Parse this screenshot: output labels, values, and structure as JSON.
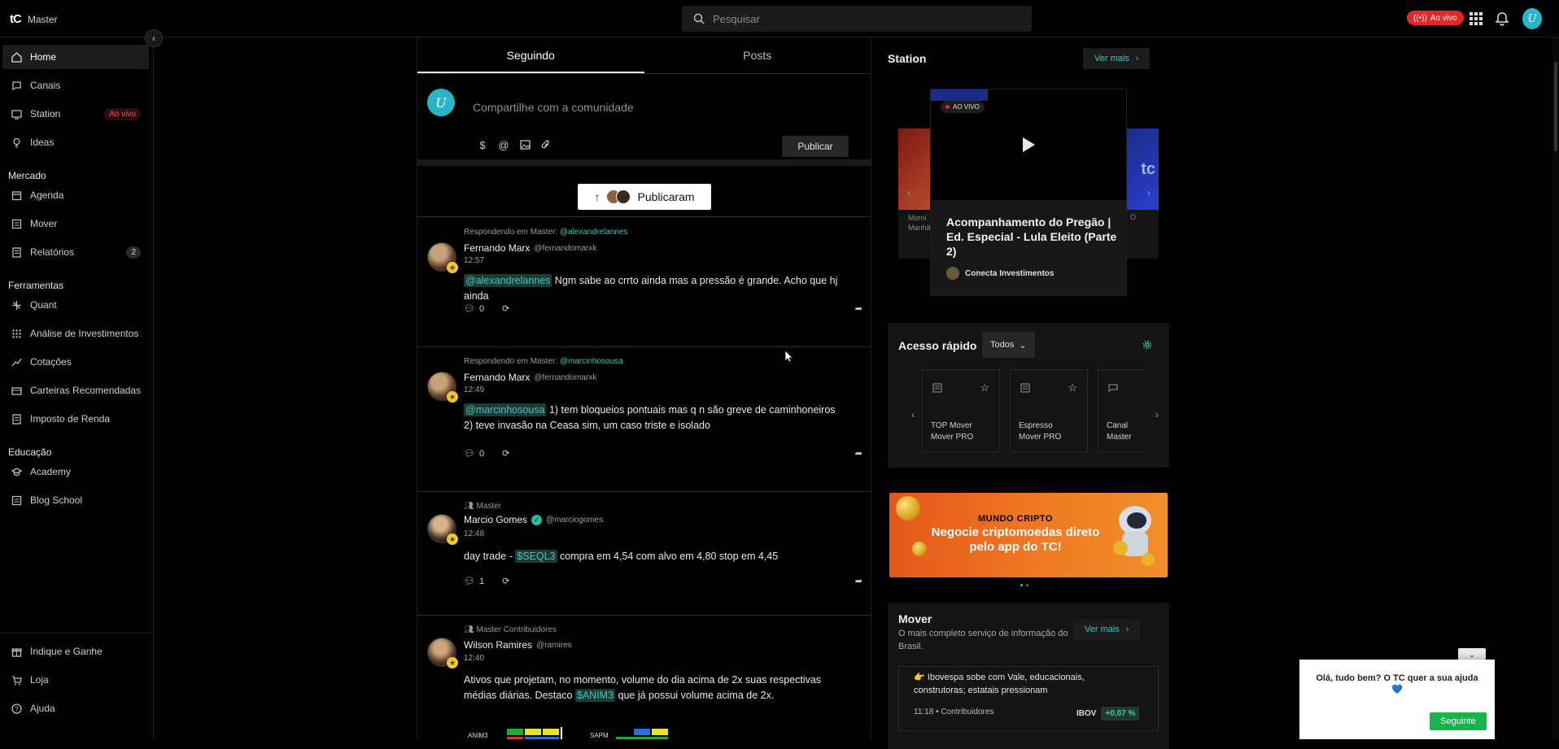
{
  "brand": {
    "logo": "tC",
    "plan": "Master"
  },
  "search": {
    "placeholder": "Pesquisar"
  },
  "topbar": {
    "live_label": "Ao vivo",
    "user_initial": "U"
  },
  "sidebar": {
    "items": [
      {
        "label": "Home",
        "icon": "home-icon"
      },
      {
        "label": "Canais",
        "icon": "channels-icon"
      },
      {
        "label": "Station",
        "icon": "tv-icon",
        "badge": "Ao vivo"
      },
      {
        "label": "Ideas",
        "icon": "lightbulb-icon"
      }
    ],
    "sections": [
      {
        "title": "Mercado",
        "items": [
          {
            "label": "Agenda"
          },
          {
            "label": "Mover"
          },
          {
            "label": "Relatórios",
            "count": "2"
          }
        ]
      },
      {
        "title": "Ferramentas",
        "items": [
          {
            "label": "Quant"
          },
          {
            "label": "Análise de Investimentos"
          },
          {
            "label": "Cotações"
          },
          {
            "label": "Carteiras Recomendadas"
          },
          {
            "label": "Imposto de Renda"
          }
        ]
      },
      {
        "title": "Educação",
        "items": [
          {
            "label": "Academy"
          },
          {
            "label": "Blog School"
          }
        ]
      }
    ],
    "bottom": [
      {
        "label": "Indique e Ganhe"
      },
      {
        "label": "Loja"
      },
      {
        "label": "Ajuda"
      }
    ]
  },
  "feed": {
    "tabs": [
      {
        "label": "Seguindo",
        "active": true
      },
      {
        "label": "Posts",
        "active": false
      }
    ],
    "composer": {
      "placeholder": "Compartilhe com a comunidade",
      "publish_label": "Publicar",
      "user_initial": "U"
    },
    "published_label": "Publicaram",
    "posts": [
      {
        "context_prefix": "Respondendo em Master:",
        "context_mention": "@alexandrelannes",
        "author": "Fernando Marx",
        "handle": "@fernandomarxk",
        "time": "12:57",
        "tag": "@alexandrelannes",
        "text": "Ngm sabe ao crrto ainda mas a pressão é grande. Acho que hj ainda",
        "comments": "0"
      },
      {
        "context_prefix": "Respondendo em Master:",
        "context_mention": "@marcinhosousa",
        "author": "Fernando Marx",
        "handle": "@fernandomarxk",
        "time": "12:49",
        "tag": "@marcinhosousa",
        "text": "1) tem bloqueios pontuais mas q n são greve de caminhoneiros",
        "text2": "2) teve invasão na Ceasa sim, um caso triste e isolado",
        "comments": "0"
      },
      {
        "context_prefix": "Master",
        "author": "Marcio Gomes",
        "handle": "@marciogomes",
        "time": "12:48",
        "text_before": "day trade -",
        "tag": "$SEQL3",
        "text": "compra em 4,54 com alvo em 4,80 stop em 4,45",
        "comments": "1"
      },
      {
        "context_prefix": "Master Contribuidores",
        "author": "Wilson Ramires",
        "handle": "@ramires",
        "time": "12:40",
        "text": "Ativos que projetam, no momento, volume do dia acima de 2x suas respectivas",
        "text2_before": "médias diárias. Destaco",
        "tag": "$ANIM3",
        "text2_after": "que já possui volume acima de 2x.",
        "chart_labels": [
          "ANIM3",
          "SAPM"
        ]
      }
    ]
  },
  "station": {
    "title": "Station",
    "ver_mais": "Ver mais",
    "live_badge": "AO VIVO",
    "featured_title": "Acompanhamento do Pregão | Ed. Especial - Lula Eleito (Parte 2)",
    "channel": "Conecta Investimentos",
    "side_left_caption": "Morni Manhã",
    "side_right_caption": "O",
    "right_logo": "tc"
  },
  "quick_access": {
    "title": "Acesso rápido",
    "filter": "Todos",
    "cards": [
      {
        "label": "TOP Mover Mover PRO"
      },
      {
        "label": "Espresso Mover PRO"
      },
      {
        "label": "Canal Master"
      }
    ]
  },
  "banner": {
    "top": "MUNDO CRIPTO",
    "main": "Negocie criptomoedas direto pelo app do TC!"
  },
  "mover": {
    "title": "Mover",
    "description": "O mais completo serviço de informação do Brasil.",
    "ver_mais": "Ver mais",
    "news": [
      {
        "emoji": "👉",
        "text": "Ibovespa sobe com Vale, educacionais, construtoras; estatais pressionam",
        "time": "11:18",
        "source": "Contribuidores",
        "ticker": "IBOV",
        "change": "+0,07 %"
      }
    ]
  },
  "chat": {
    "text": "Olá, tudo bem? O TC quer a sua ajuda",
    "button": "Seguinte"
  },
  "colors": {
    "accent": "#3cc6b8",
    "live": "#e5262b",
    "background": "#000000"
  }
}
